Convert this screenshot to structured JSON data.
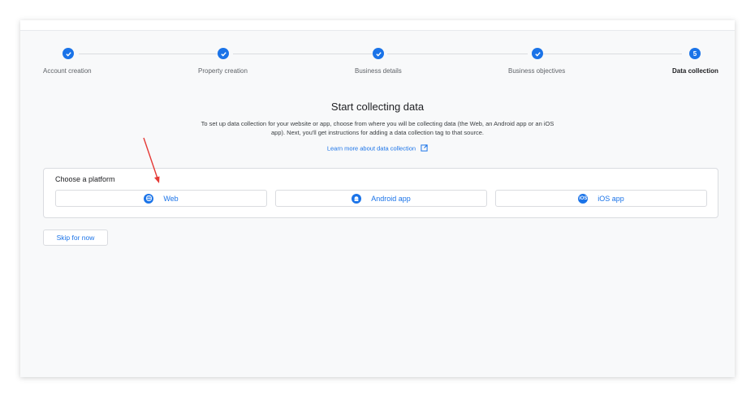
{
  "stepper": {
    "steps": [
      {
        "label": "Account creation",
        "state": "done"
      },
      {
        "label": "Property creation",
        "state": "done"
      },
      {
        "label": "Business details",
        "state": "done"
      },
      {
        "label": "Business objectives",
        "state": "done"
      },
      {
        "label": "Data collection",
        "state": "active",
        "number": "5"
      }
    ]
  },
  "main": {
    "title": "Start collecting data",
    "description": "To set up data collection for your website or app, choose from where you will be collecting data (the Web, an Android app or an iOS app). Next, you'll get instructions for adding a data collection tag to that source.",
    "learn_more": "Learn more about data collection"
  },
  "platform": {
    "title": "Choose a platform",
    "options": [
      {
        "label": "Web",
        "icon": "globe-icon"
      },
      {
        "label": "Android app",
        "icon": "android-icon"
      },
      {
        "label": "iOS app",
        "icon": "ios-icon",
        "badge": "iOS"
      }
    ]
  },
  "skip_label": "Skip for now",
  "colors": {
    "accent": "#1a73e8",
    "annotation_arrow": "#e53935"
  }
}
